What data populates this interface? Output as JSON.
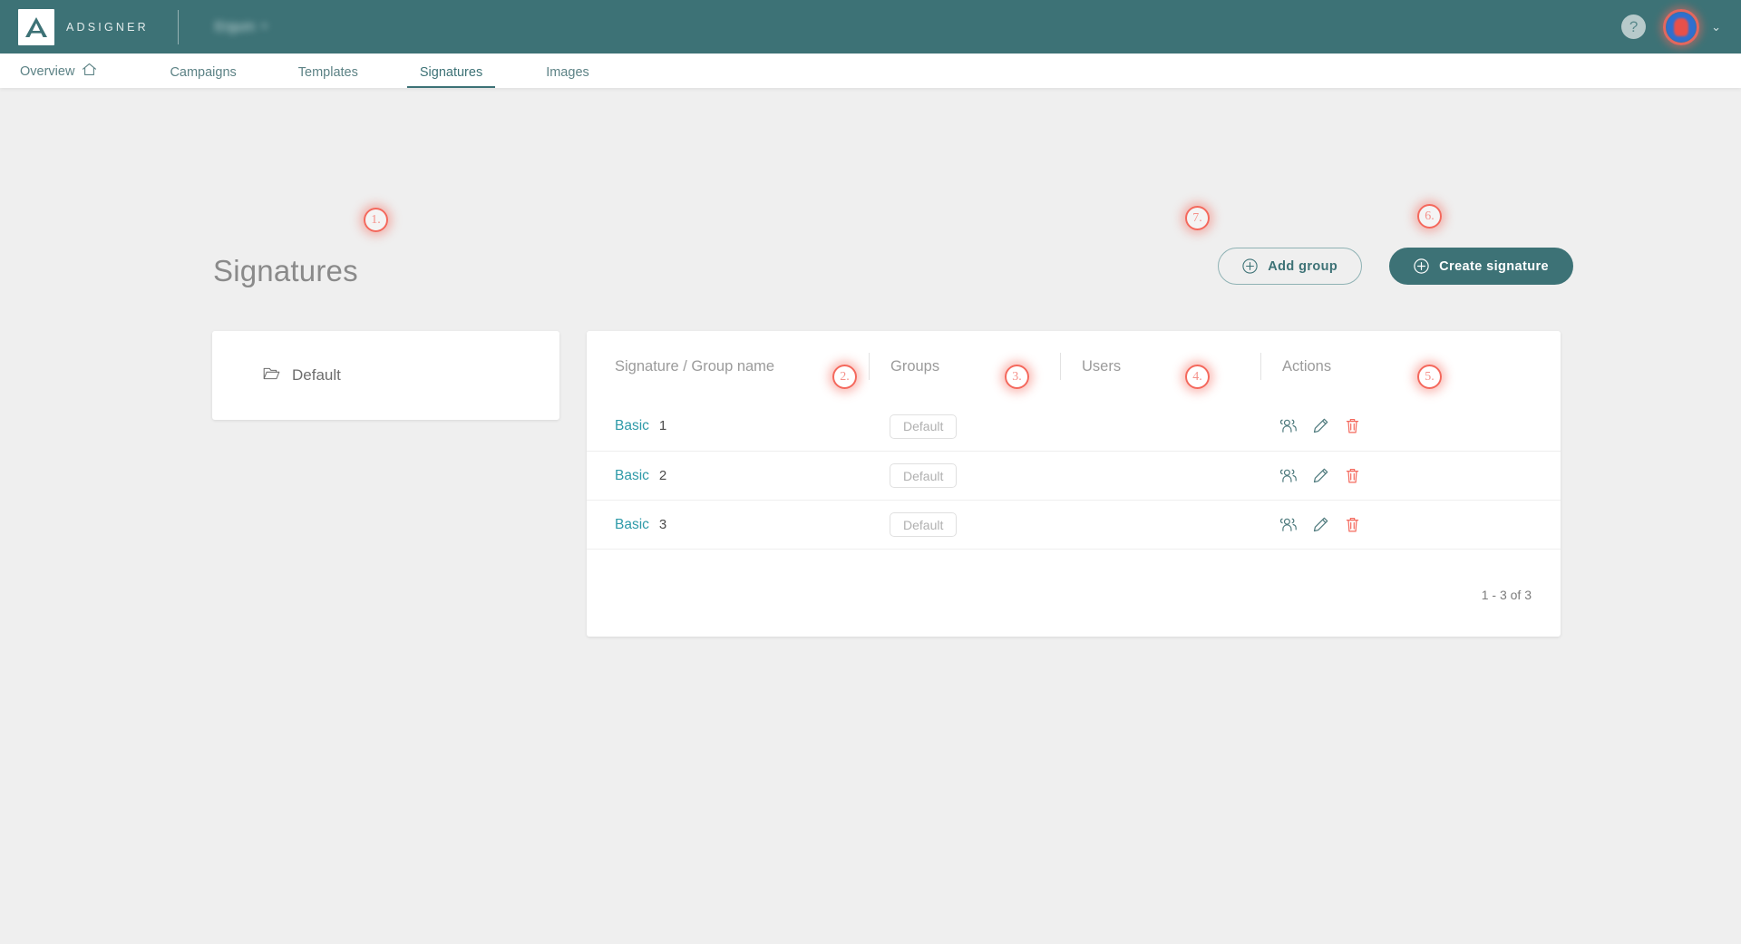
{
  "header": {
    "brand_name": "ADSIGNER",
    "company_name": "Ergum",
    "company_caret": "▾",
    "help_label": "?",
    "account_caret": "⌄",
    "brand_teal": "#3d7276",
    "accent_coral": "#f4685c"
  },
  "nav": {
    "tabs": [
      {
        "label": "Overview",
        "icon": "home-icon",
        "active": false
      },
      {
        "label": "Campaigns",
        "icon": "",
        "active": false
      },
      {
        "label": "Templates",
        "icon": "",
        "active": false
      },
      {
        "label": "Signatures",
        "icon": "",
        "active": true
      },
      {
        "label": "Images",
        "icon": "",
        "active": false
      }
    ]
  },
  "main": {
    "page_title": "Signatures",
    "add_group_label": "Add group",
    "create_signature_label": "Create signature"
  },
  "folder_panel": {
    "icon": "folder-icon",
    "label": "Default"
  },
  "table": {
    "columns": [
      "Signature / Group name",
      "Groups",
      "Users",
      "Actions"
    ],
    "rows": [
      {
        "name": "Basic",
        "index": "1",
        "group_chip": "Default",
        "users": ""
      },
      {
        "name": "Basic",
        "index": "2",
        "group_chip": "Default",
        "users": ""
      },
      {
        "name": "Basic",
        "index": "3",
        "group_chip": "Default",
        "users": ""
      }
    ],
    "row_actions": [
      "users-icon",
      "edit-pencil-icon",
      "delete-trash-icon"
    ],
    "pagination": "1 - 3 of 3"
  },
  "annotations": [
    {
      "id": "1",
      "text": "1.",
      "target": "folder-panel"
    },
    {
      "id": "2",
      "text": "2.",
      "target": "column-signature-group-name"
    },
    {
      "id": "3",
      "text": "3.",
      "target": "column-groups"
    },
    {
      "id": "4",
      "text": "4.",
      "target": "column-users"
    },
    {
      "id": "5",
      "text": "5.",
      "target": "column-actions"
    },
    {
      "id": "7",
      "text": "7.",
      "target": "add-group-button"
    },
    {
      "id": "6",
      "text": "6.",
      "target": "create-signature-button"
    }
  ]
}
